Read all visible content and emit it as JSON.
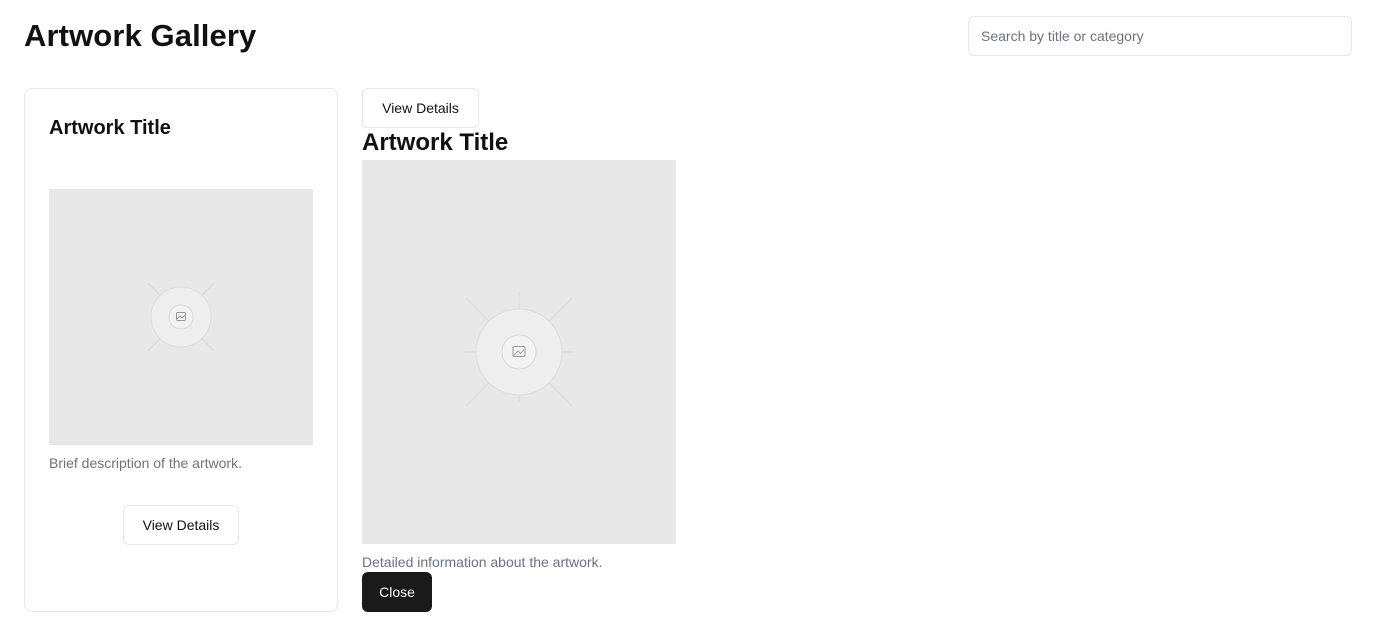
{
  "header": {
    "title": "Artwork Gallery",
    "search_placeholder": "Search by title or category"
  },
  "gallery": {
    "cards": [
      {
        "title": "Artwork Title",
        "image_icon": "image-placeholder-icon",
        "description": "Brief description of the artwork.",
        "button_label": "View Details"
      }
    ]
  },
  "detail": {
    "view_button_label": "View Details",
    "title": "Artwork Title",
    "image_icon": "image-placeholder-icon",
    "description": "Detailed information about the artwork.",
    "close_label": "Close"
  },
  "colors": {
    "placeholder_bg": "#e8e8e8",
    "muted_text": "#6b7280",
    "border": "#e5e7eb",
    "dark_button": "#1a1a1a"
  }
}
